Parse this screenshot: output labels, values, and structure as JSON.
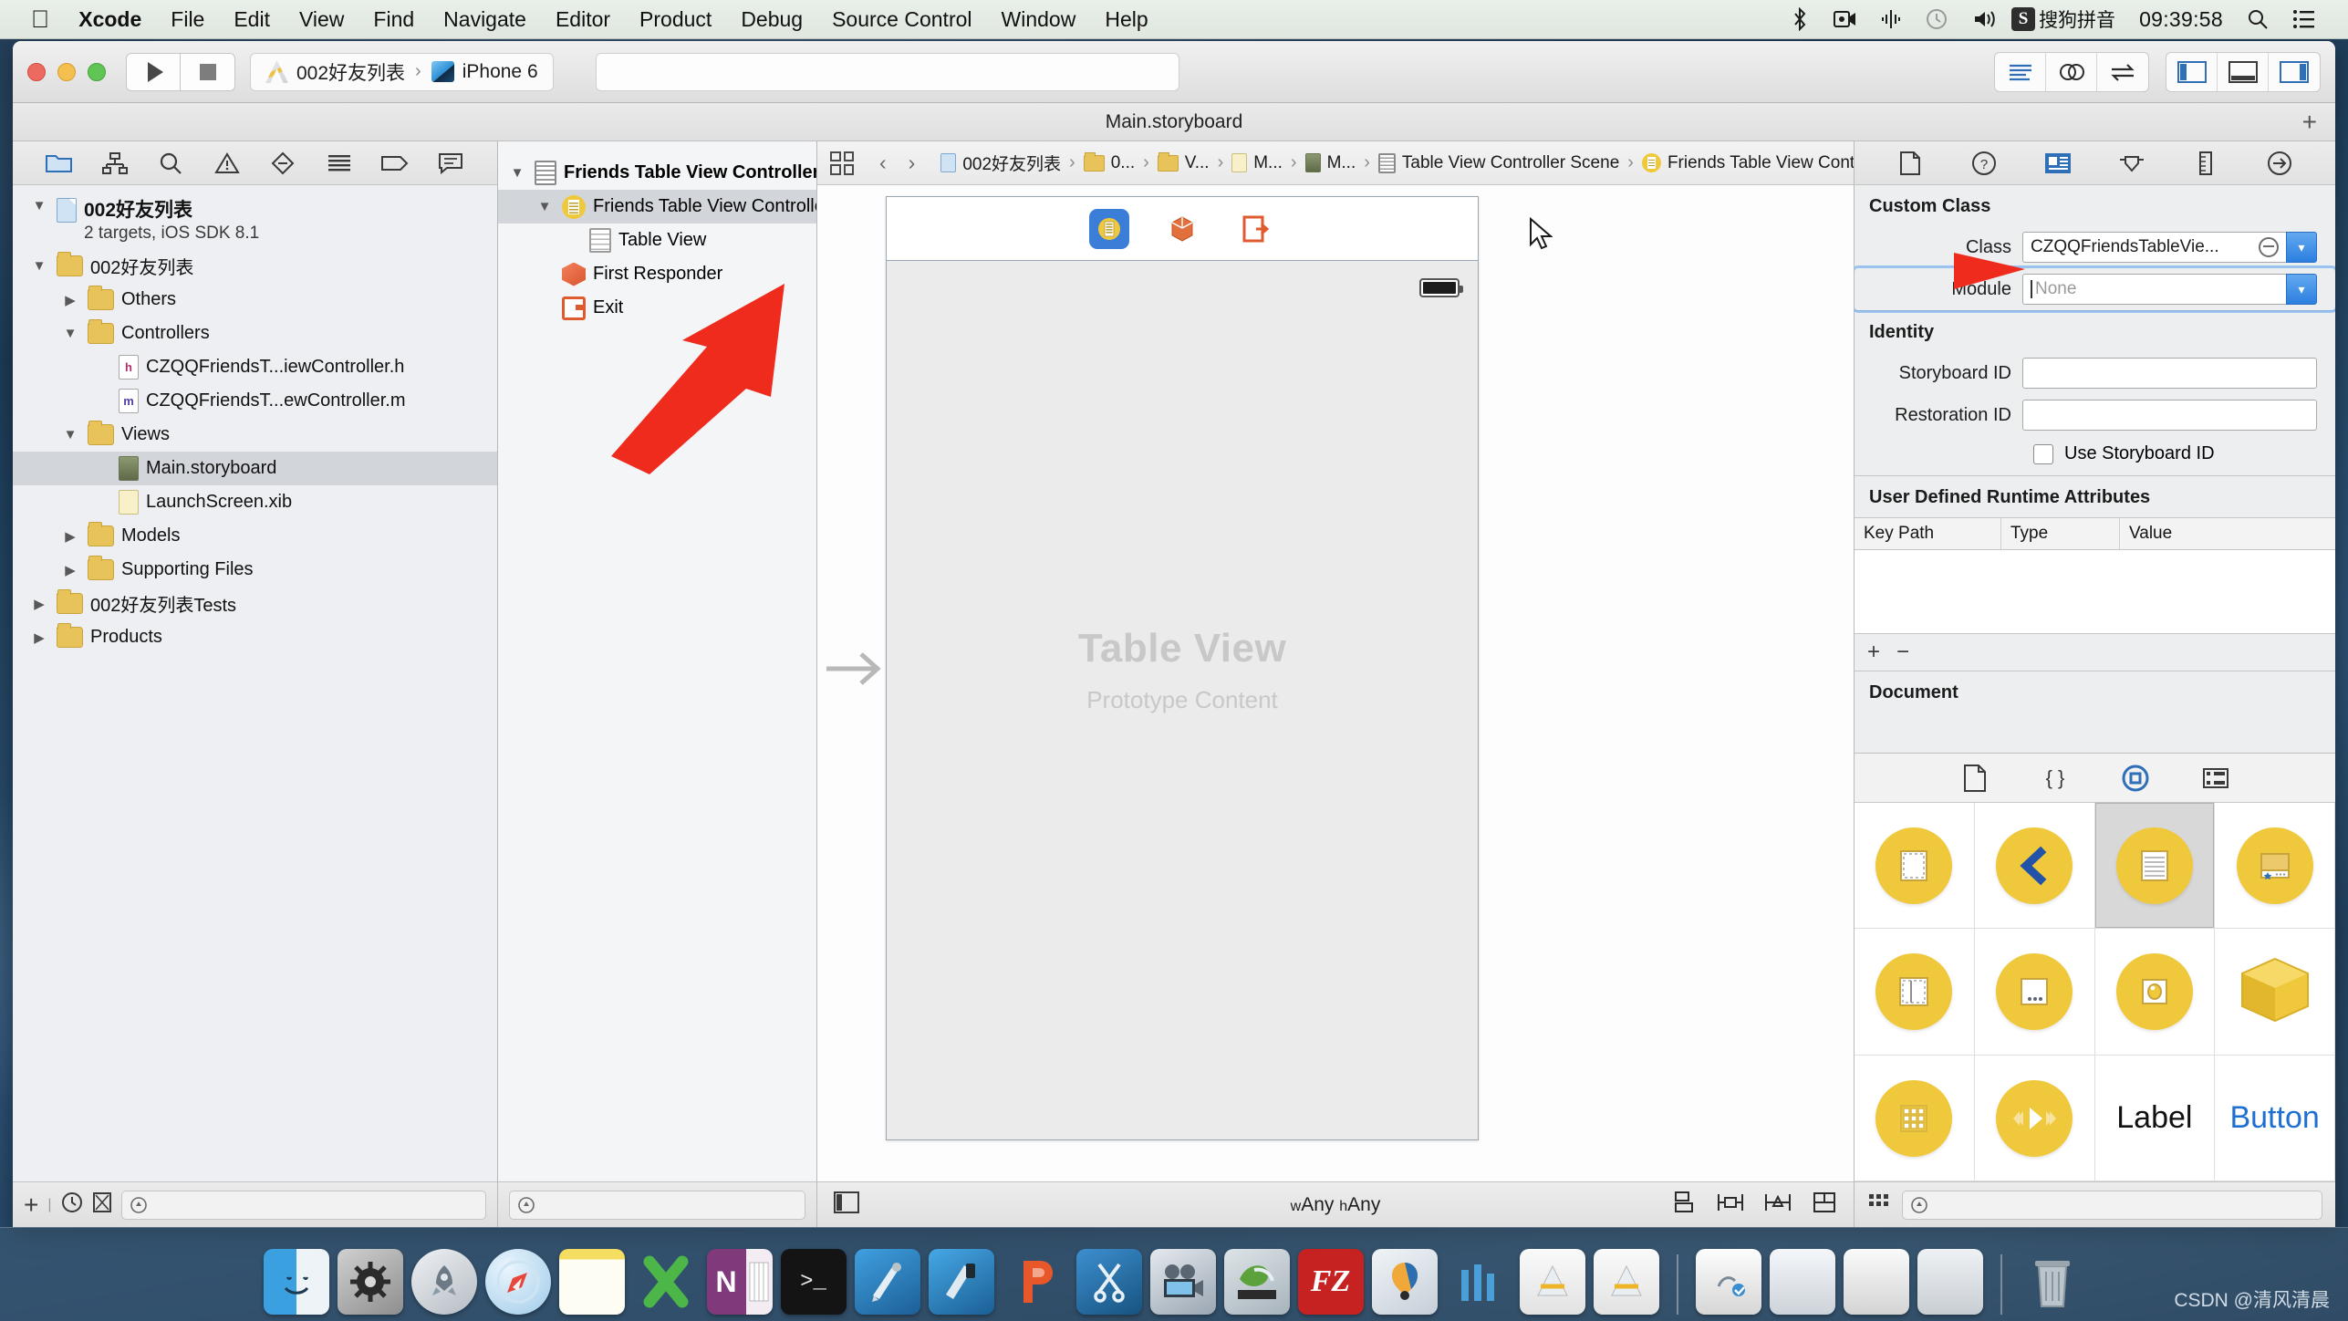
{
  "menubar": {
    "apple": "apple-logo",
    "items": [
      "Xcode",
      "File",
      "Edit",
      "View",
      "Find",
      "Navigate",
      "Editor",
      "Product",
      "Debug",
      "Source Control",
      "Window",
      "Help"
    ],
    "status": {
      "ime_badge": "S",
      "ime_label": "搜狗拼音",
      "time": "09:39:58",
      "icons": [
        "bluetooth-icon",
        "screen-record-icon",
        "airplay-icon",
        "time-machine-icon",
        "volume-icon"
      ],
      "search": "spotlight-icon",
      "notification": "notification-center-icon"
    }
  },
  "toolbar": {
    "run_button": "run-icon",
    "stop_button": "stop-icon",
    "scheme_project": "002好友列表",
    "scheme_sep": "›",
    "scheme_device": "iPhone 6",
    "activity_placeholder": "",
    "editor_modes": [
      "standard-editor-icon",
      "assistant-editor-icon",
      "version-editor-icon"
    ],
    "panel_toggles": [
      "navigator-toggle-icon",
      "debug-area-toggle-icon",
      "utilities-toggle-icon"
    ],
    "add_button": "+"
  },
  "window": {
    "title": "Main.storyboard"
  },
  "navigator": {
    "tabs": [
      "project-navigator-icon",
      "symbol-navigator-icon",
      "find-navigator-icon",
      "issue-navigator-icon",
      "test-navigator-icon",
      "debug-navigator-icon",
      "breakpoint-navigator-icon",
      "report-navigator-icon"
    ],
    "project": {
      "name": "002好友列表",
      "subtitle": "2 targets, iOS SDK 8.1"
    },
    "tree": [
      {
        "label": "002好友列表",
        "type": "folder",
        "indent": 1,
        "twisty": "▼",
        "selected": false
      },
      {
        "label": "Others",
        "type": "folder",
        "indent": 2,
        "twisty": "▶",
        "selected": false
      },
      {
        "label": "Controllers",
        "type": "folder",
        "indent": 2,
        "twisty": "▼",
        "selected": false
      },
      {
        "label": "CZQQFriendsT...iewController.h",
        "type": "header",
        "indent": 3,
        "twisty": "",
        "selected": false
      },
      {
        "label": "CZQQFriendsT...ewController.m",
        "type": "impl",
        "indent": 3,
        "twisty": "",
        "selected": false
      },
      {
        "label": "Views",
        "type": "folder",
        "indent": 2,
        "twisty": "▼",
        "selected": false
      },
      {
        "label": "Main.storyboard",
        "type": "storyboard",
        "indent": 3,
        "twisty": "",
        "selected": true
      },
      {
        "label": "LaunchScreen.xib",
        "type": "xib",
        "indent": 3,
        "twisty": "",
        "selected": false
      },
      {
        "label": "Models",
        "type": "folder",
        "indent": 2,
        "twisty": "▶",
        "selected": false
      },
      {
        "label": "Supporting Files",
        "type": "folder",
        "indent": 2,
        "twisty": "▶",
        "selected": false
      },
      {
        "label": "002好友列表Tests",
        "type": "folder",
        "indent": 1,
        "twisty": "▶",
        "selected": false
      },
      {
        "label": "Products",
        "type": "folder",
        "indent": 1,
        "twisty": "▶",
        "selected": false
      }
    ],
    "footer": {
      "add": "+",
      "recent": "recent-icon",
      "unsaved": "unsaved-icon",
      "filter_placeholder": ""
    }
  },
  "outline": {
    "tree": [
      {
        "label": "Friends Table View Controller Scene",
        "type": "scene",
        "indent": 0,
        "twisty": "▼",
        "selected": false,
        "bold": true
      },
      {
        "label": "Friends Table View Controller",
        "type": "viewcontroller",
        "indent": 1,
        "twisty": "▼",
        "selected": true,
        "bold": false
      },
      {
        "label": "Table View",
        "type": "tableview",
        "indent": 2,
        "twisty": "",
        "selected": false,
        "bold": false
      },
      {
        "label": "First Responder",
        "type": "firstresponder",
        "indent": 1,
        "twisty": "",
        "selected": false,
        "bold": false
      },
      {
        "label": "Exit",
        "type": "exit",
        "indent": 1,
        "twisty": "",
        "selected": false,
        "bold": false
      }
    ],
    "footer": {
      "filter_placeholder": ""
    }
  },
  "jumpbar": {
    "related_icon": "related-items-icon",
    "back": "‹",
    "forward": "›",
    "crumbs": [
      {
        "label": "002好友列表",
        "icon": "project-icon"
      },
      {
        "label": "0...",
        "icon": "folder-icon"
      },
      {
        "label": "V...",
        "icon": "folder-icon"
      },
      {
        "label": "M...",
        "icon": "xib-icon"
      },
      {
        "label": "M...",
        "icon": "storyboard-icon"
      },
      {
        "label": "Table View Controller Scene",
        "icon": "scene-icon"
      },
      {
        "label": "Friends Table View Controller",
        "icon": "viewcontroller-icon"
      }
    ],
    "separator": "›"
  },
  "canvas": {
    "scene_bar_icons": [
      "view-controller-icon",
      "first-responder-icon",
      "exit-icon"
    ],
    "table_view_title": "Table View",
    "table_view_subtitle": "Prototype Content",
    "battery": "battery-icon",
    "entry_arrow": "initial-scene-arrow"
  },
  "canvas_footer": {
    "outline_toggle": "document-outline-toggle-icon",
    "size_class": "wAny hAny",
    "size_class_w": "w",
    "size_class_h": "h",
    "constraint_buttons": [
      "align-icon",
      "pin-icon",
      "resolve-auto-layout-icon",
      "resizing-behavior-icon"
    ]
  },
  "inspector": {
    "tabs": [
      "file-inspector-icon",
      "quick-help-icon",
      "identity-inspector-icon",
      "attributes-inspector-icon",
      "size-inspector-icon",
      "connections-inspector-icon"
    ],
    "custom_class": {
      "header": "Custom Class",
      "class_label": "Class",
      "class_value": "CZQQFriendsTableVie...",
      "module_label": "Module",
      "module_placeholder": "None",
      "module_value": ""
    },
    "identity": {
      "header": "Identity",
      "storyboard_id_label": "Storyboard ID",
      "storyboard_id_value": "",
      "restoration_id_label": "Restoration ID",
      "restoration_id_value": "",
      "use_storyboard_id_label": "Use Storyboard ID",
      "use_storyboard_id_checked": false
    },
    "user_defined": {
      "header": "User Defined Runtime Attributes",
      "columns": [
        "Key Path",
        "Type",
        "Value"
      ],
      "rows": [],
      "add": "+",
      "remove": "−"
    },
    "document": {
      "header": "Document"
    }
  },
  "library": {
    "tabs": [
      "file-template-library-icon",
      "code-snippet-library-icon",
      "object-library-icon",
      "media-library-icon"
    ],
    "selected_tab_index": 2,
    "items": [
      {
        "name": "view-controller-item",
        "kind": "disc-dashed-rect",
        "selected": false
      },
      {
        "name": "navigation-controller-item",
        "kind": "disc-back-chevron",
        "selected": false
      },
      {
        "name": "table-view-controller-item",
        "kind": "disc-lined-page",
        "selected": true
      },
      {
        "name": "tab-bar-controller-item",
        "kind": "disc-tabbar",
        "selected": false
      },
      {
        "name": "split-view-controller-item",
        "kind": "disc-split",
        "selected": false
      },
      {
        "name": "page-view-controller-item",
        "kind": "disc-page-dots",
        "selected": false
      },
      {
        "name": "gl-kit-view-controller-item",
        "kind": "disc-circle-inset",
        "selected": false
      },
      {
        "name": "object-item",
        "kind": "cube",
        "selected": false
      },
      {
        "name": "collection-view-controller-item",
        "kind": "disc-grid",
        "selected": false
      },
      {
        "name": "avplayer-view-controller-item",
        "kind": "disc-play",
        "selected": false
      },
      {
        "name": "label-item",
        "kind": "word",
        "label": "Label",
        "selected": false
      },
      {
        "name": "button-item",
        "kind": "word-blue",
        "label": "Button",
        "selected": false
      }
    ],
    "footer": {
      "filter_placeholder": ""
    }
  },
  "dock": {
    "items": [
      {
        "name": "finder",
        "color1": "#4da6e8",
        "color2": "#e9eef2",
        "glyph": "☺"
      },
      {
        "name": "system-preferences",
        "color1": "#b8b8b8",
        "color2": "#7f7f7f",
        "glyph": "⚙"
      },
      {
        "name": "launchpad",
        "color1": "#d9dde1",
        "color2": "#a9b0b7",
        "glyph": "Ὠ0"
      },
      {
        "name": "safari",
        "color1": "#e8f3fb",
        "color2": "#a8cfe8",
        "glyph": "⦿"
      },
      {
        "name": "notes",
        "color1": "#f7e27a",
        "color2": "#fdfdf2",
        "glyph": ""
      },
      {
        "name": "microsoft-excel",
        "color1": "#1f7a44",
        "color2": "#4cb96b",
        "glyph": "X"
      },
      {
        "name": "microsoft-onenote",
        "color1": "#80397b",
        "color2": "#f1e9f0",
        "glyph": "N"
      },
      {
        "name": "terminal",
        "color1": "#1a1a1a",
        "color2": "#333333",
        "glyph": ">_"
      },
      {
        "name": "xcode-build",
        "color1": "#2a86cf",
        "color2": "#7fc4ef",
        "glyph": "⚒"
      },
      {
        "name": "instruments",
        "color1": "#2a86cf",
        "color2": "#9fd4f5",
        "glyph": ""
      },
      {
        "name": "keynote",
        "color1": "#e8572a",
        "color2": "#f79267",
        "glyph": "P"
      },
      {
        "name": "snipping-tool",
        "color1": "#2a6fb0",
        "color2": "#6fb3e0",
        "glyph": "✂"
      },
      {
        "name": "movie-maker",
        "color1": "#cfd6dd",
        "color2": "#8d99a6",
        "glyph": "ἺC"
      },
      {
        "name": "mplayer",
        "color1": "#5b9e3c",
        "color2": "#c9d4da",
        "glyph": ""
      },
      {
        "name": "filezilla",
        "color1": "#c02020",
        "color2": "#e24a4a",
        "glyph": "FZ"
      },
      {
        "name": "parallels",
        "color1": "#e8a53a",
        "color2": "#2b6fb0",
        "glyph": ""
      },
      {
        "name": "iwork-numbers",
        "color1": "#4a9fd8",
        "color2": "#9fd0ee",
        "glyph": ""
      },
      {
        "name": "xcode-alt-1",
        "color1": "#f2f2f2",
        "color2": "#d8d8d8",
        "glyph": ""
      },
      {
        "name": "xcode-alt-2",
        "color1": "#f2f2f2",
        "color2": "#d8d8d8",
        "glyph": ""
      }
    ],
    "docked_items": [
      {
        "name": "document-window-1",
        "color1": "#f0f0f0",
        "color2": "#cfcfcf"
      },
      {
        "name": "document-window-2",
        "color1": "#eef1f4",
        "color2": "#c9ced3"
      },
      {
        "name": "document-window-3",
        "color1": "#f4f4f4",
        "color2": "#d2d2d2"
      },
      {
        "name": "document-window-4",
        "color1": "#e8ecef",
        "color2": "#c4c9ce"
      }
    ],
    "trash": {
      "name": "trash"
    }
  },
  "watermark": {
    "text": "CSDN @清风清晨"
  }
}
